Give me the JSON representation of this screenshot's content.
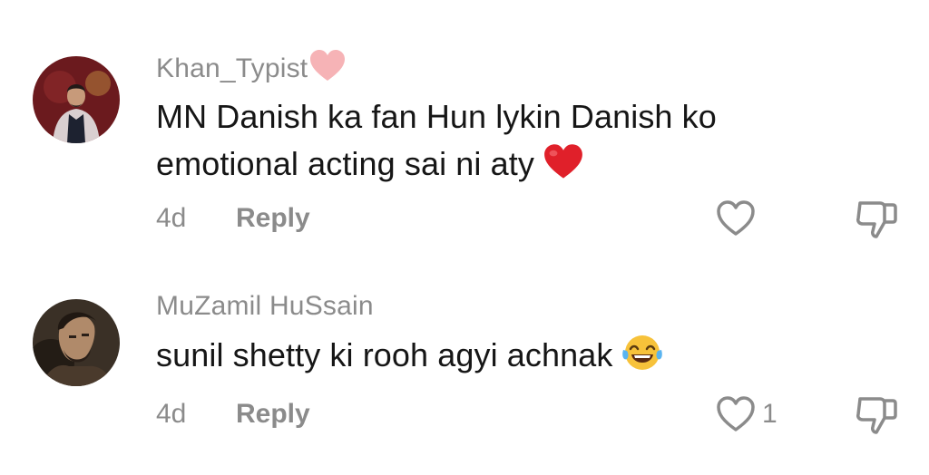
{
  "comments": [
    {
      "username": "Khan_Typist",
      "username_emoji": "pink-heart-icon",
      "text": "MN Danish ka fan Hun lykin Danish ko emotional acting sai ni aty",
      "text_emoji": "red-heart-icon",
      "time": "4d",
      "reply_label": "Reply",
      "like_count": ""
    },
    {
      "username": "MuZamil HuSsain",
      "text": "sunil shetty ki rooh agyi achnak",
      "text_emoji": "face-with-tears-of-joy-icon",
      "time": "4d",
      "reply_label": "Reply",
      "like_count": "1"
    }
  ],
  "colors": {
    "secondary_text": "#8b8b8b",
    "primary_text": "#161616",
    "pink_heart": "#f6b3b6",
    "red_heart": "#e0202a"
  }
}
